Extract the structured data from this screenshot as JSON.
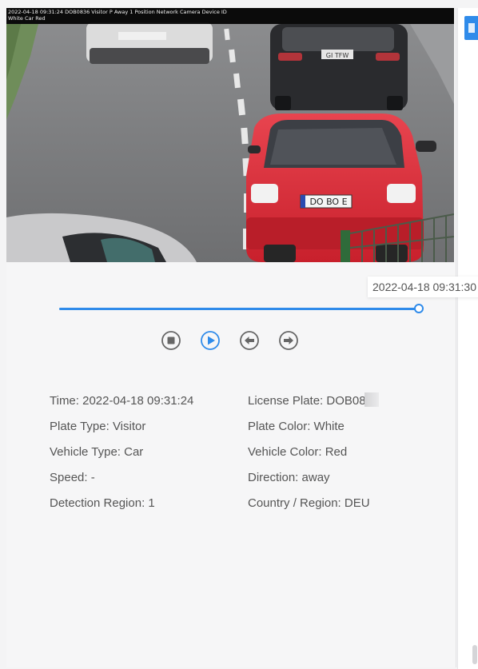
{
  "video": {
    "osd_line1": "2022-04-18 09:31:24 DOB0836 Visitor P Away 1 Position Network Camera Device ID",
    "osd_line2": "White Car Red",
    "front_plate": "DO BO E",
    "rear_plate": "GI TFW"
  },
  "timeline": {
    "tooltip": "2022-04-18 09:31:30",
    "progress": 1.0
  },
  "controls": [
    {
      "name": "stop-button",
      "icon": "stop-icon"
    },
    {
      "name": "play-button",
      "icon": "play-icon",
      "accent": "#2f8bea"
    },
    {
      "name": "previous-button",
      "icon": "arrow-left-icon"
    },
    {
      "name": "next-button",
      "icon": "arrow-right-icon"
    }
  ],
  "details": {
    "time": "Time: 2022-04-18 09:31:24",
    "license_plate": "License Plate: DOB08",
    "plate_type": "Plate Type: Visitor",
    "plate_color": "Plate Color: White",
    "vehicle_type": "Vehicle Type: Car",
    "vehicle_color": "Vehicle Color: Red",
    "speed": "Speed: -",
    "direction": "Direction: away",
    "detection_region": "Detection Region: 1",
    "country_region": "Country / Region: DEU"
  },
  "colors": {
    "accent": "#2f8bea",
    "text": "#555555",
    "panel": "#f6f6f7"
  }
}
